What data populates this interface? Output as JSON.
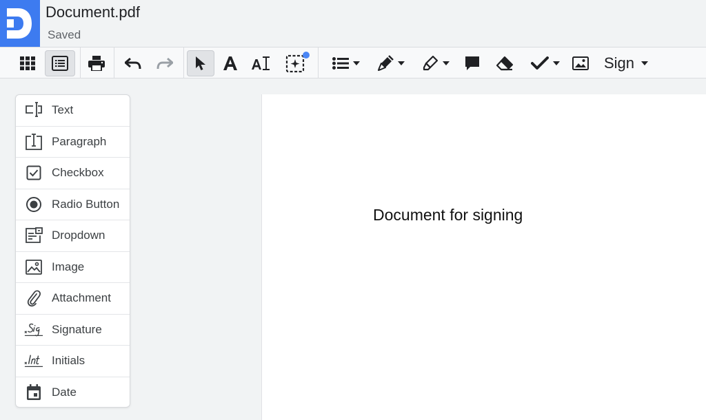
{
  "header": {
    "title": "Document.pdf",
    "status": "Saved"
  },
  "toolbar": {
    "sign_label": "Sign",
    "buttons": [
      {
        "name": "grid-view",
        "icon": "grid-icon"
      },
      {
        "name": "form-view",
        "icon": "form-list-icon",
        "active": true
      },
      {
        "name": "print",
        "icon": "printer-icon"
      },
      {
        "name": "undo",
        "icon": "undo-icon"
      },
      {
        "name": "redo",
        "icon": "redo-icon"
      },
      {
        "name": "select",
        "icon": "cursor-arrow-icon",
        "active": true
      },
      {
        "name": "text",
        "icon": "text-a-icon"
      },
      {
        "name": "text-edit",
        "icon": "text-edit-icon"
      },
      {
        "name": "ai-select",
        "icon": "sparkle-select-icon"
      },
      {
        "name": "list",
        "icon": "list-icon"
      },
      {
        "name": "pen",
        "icon": "pen-icon"
      },
      {
        "name": "highlighter",
        "icon": "highlighter-icon"
      },
      {
        "name": "comment",
        "icon": "comment-icon"
      },
      {
        "name": "eraser",
        "icon": "eraser-icon"
      },
      {
        "name": "checkmark",
        "icon": "checkmark-icon"
      },
      {
        "name": "image",
        "icon": "image-icon"
      }
    ]
  },
  "fields": [
    {
      "label": "Text",
      "icon": "text-field-icon"
    },
    {
      "label": "Paragraph",
      "icon": "paragraph-icon"
    },
    {
      "label": "Checkbox",
      "icon": "checkbox-icon"
    },
    {
      "label": "Radio Button",
      "icon": "radio-button-icon"
    },
    {
      "label": "Dropdown",
      "icon": "dropdown-icon"
    },
    {
      "label": "Image",
      "icon": "image-icon"
    },
    {
      "label": "Attachment",
      "icon": "paperclip-icon"
    },
    {
      "label": "Signature",
      "icon": "signature-icon"
    },
    {
      "label": "Initials",
      "icon": "initials-icon"
    },
    {
      "label": "Date",
      "icon": "calendar-icon"
    }
  ],
  "document": {
    "text": "Document for signing"
  },
  "colors": {
    "brand": "#3d7bf0",
    "badge": "#4a86f5"
  }
}
